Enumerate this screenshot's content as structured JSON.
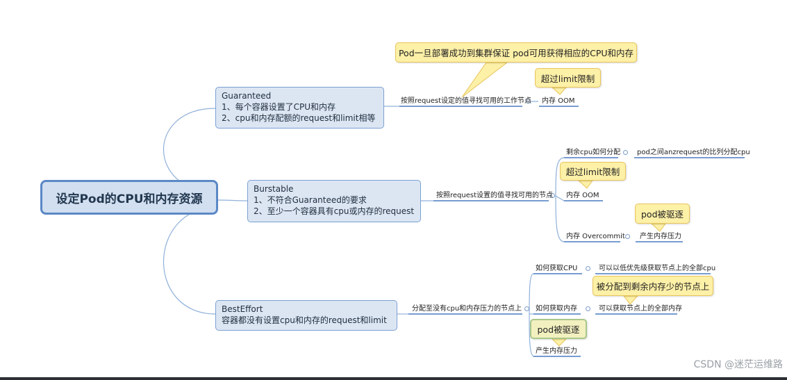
{
  "root": "设定Pod的CPU和内存资源",
  "guaranteed": {
    "title": "Guaranteed",
    "line1": "1、每个容器设置了CPU和内存",
    "line2": "2、cpu和内存配额的request和limit相等",
    "branch": "按照request设定的值寻找可用的工作节点",
    "leaf": "内存  OOM",
    "callout_top": "Pod一旦部署成功到集群保证 pod可用获得相应的CPU和内存",
    "callout_limit": "超过limit限制"
  },
  "burstable": {
    "title": "Burstable",
    "line1": "1、不符合Guaranteed的要求",
    "line2": "2、至少一个容器具有cpu或内存的request",
    "branch": "按照request设置的值寻找可用的节点",
    "cpu_label": "剩余cpu如何分配",
    "cpu_value": "pod之间anzrequest的比列分配cpu",
    "oom_label": "内存 OOM",
    "callout_limit": "超过limit限制",
    "overcommit_label": "内存 Overcommit",
    "pressure_label": "产生内存压力",
    "callout_evict": "pod被驱逐"
  },
  "besteffort": {
    "title": "BestEffort",
    "line1": "容器都没有设置cpu和内存的request和limit",
    "branch": "分配至没有cpu和内存压力的节点上",
    "cpu_label": "如何获取CPU",
    "cpu_value": "可以以低优先级获取节点上的全部cpu",
    "mem_label": "如何获取内存",
    "mem_value": "可以获取节点上的全部内存",
    "callout_assign": "被分配到剩余内存少的节点上",
    "callout_evict": "pod被驱逐",
    "pressure_label": "产生内存压力"
  },
  "watermark": "CSDN @迷茫运维路",
  "colors": {
    "node_fill": "#dce6f3",
    "node_border": "#7ba0d2",
    "callout_fill": "#fdf0a7",
    "callout_border": "#e8c55c",
    "connector": "#8fb0d9",
    "underline": "#4a7cc0"
  }
}
